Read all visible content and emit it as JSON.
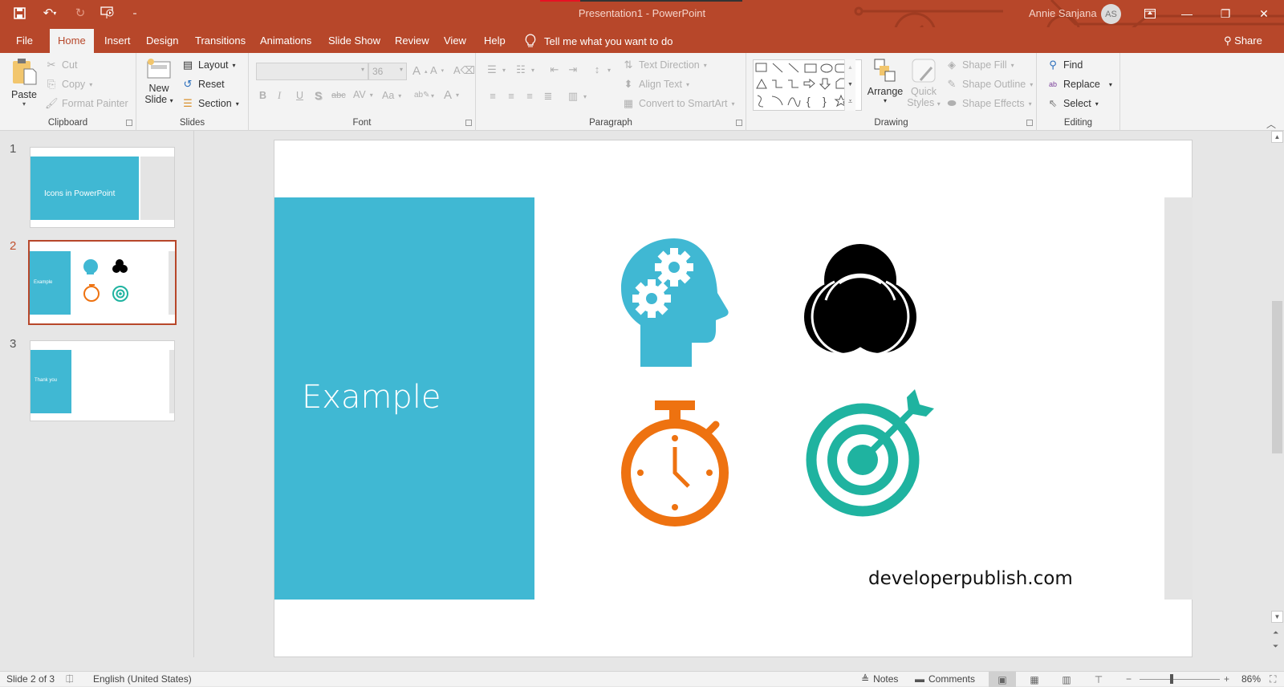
{
  "window": {
    "title": "Presentation1  -  PowerPoint",
    "user_name": "Annie Sanjana",
    "user_initials": "AS",
    "share_label": "Share",
    "tell_me": "Tell me what you want to do"
  },
  "qat": {
    "save": "save-icon",
    "undo": "undo-icon",
    "redo": "redo-icon",
    "present": "start-from-beginning-icon",
    "customize": "customize-icon"
  },
  "tabs": [
    {
      "label": "File"
    },
    {
      "label": "Home",
      "active": true
    },
    {
      "label": "Insert"
    },
    {
      "label": "Design"
    },
    {
      "label": "Transitions"
    },
    {
      "label": "Animations"
    },
    {
      "label": "Slide Show"
    },
    {
      "label": "Review"
    },
    {
      "label": "View"
    },
    {
      "label": "Help"
    }
  ],
  "ribbon": {
    "clipboard": {
      "label": "Clipboard",
      "paste": "Paste",
      "cut": "Cut",
      "copy": "Copy",
      "format_painter": "Format Painter"
    },
    "slides": {
      "label": "Slides",
      "new_slide_1": "New",
      "new_slide_2": "Slide",
      "layout": "Layout",
      "reset": "Reset",
      "section": "Section"
    },
    "font": {
      "label": "Font",
      "font_name": "",
      "font_size": "36",
      "bold": "B",
      "italic": "I",
      "underline": "U",
      "shadow": "S",
      "strikethrough": "abc",
      "spacing": "AV",
      "change_case": "Aa",
      "font_color": "A",
      "grow": "A",
      "shrink": "A"
    },
    "paragraph": {
      "label": "Paragraph",
      "text_direction": "Text Direction",
      "align_text": "Align Text",
      "convert_smartart": "Convert to SmartArt"
    },
    "drawing": {
      "label": "Drawing",
      "arrange": "Arrange",
      "quick_styles_1": "Quick",
      "quick_styles_2": "Styles",
      "shape_fill": "Shape Fill",
      "shape_outline": "Shape Outline",
      "shape_effects": "Shape Effects"
    },
    "editing": {
      "label": "Editing",
      "find": "Find",
      "replace": "Replace",
      "select": "Select"
    }
  },
  "slides_panel": [
    {
      "number": "1",
      "title": "Icons in PowerPoint"
    },
    {
      "number": "2",
      "title": "Example",
      "active": true
    },
    {
      "number": "3",
      "title": "Thank you"
    }
  ],
  "slide": {
    "title": "Example",
    "footer": "developerpublish.com",
    "icons": [
      "head-gears-icon",
      "venn-diagram-icon",
      "stopwatch-icon",
      "target-arrow-icon"
    ],
    "colors": {
      "panel": "#40b8d3",
      "head": "#40b8d3",
      "venn": "#000000",
      "stopwatch": "#ee7210",
      "target": "#1fb3a0"
    }
  },
  "status": {
    "slide_of": "Slide 2 of 3",
    "language": "English (United States)",
    "notes": "Notes",
    "comments": "Comments",
    "zoom": "86%",
    "zoom_value": 86
  },
  "theme": {
    "accent": "#b7472a"
  }
}
